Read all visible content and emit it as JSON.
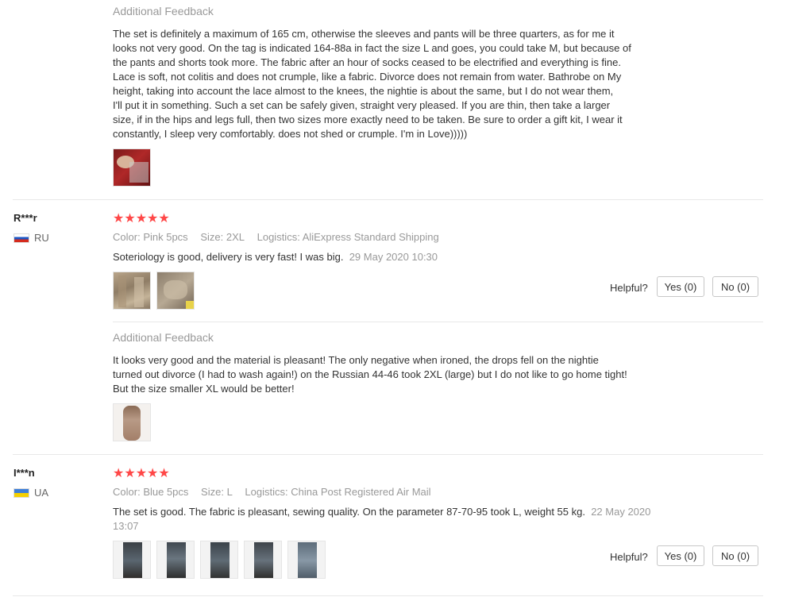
{
  "reviews": [
    {
      "feedback_title": "Additional Feedback",
      "feedback_lines": [
        "The set is definitely a maximum of 165 cm, otherwise the sleeves and pants will be three quarters, as for me it",
        "looks not very good. On the tag is indicated 164-88a in fact the size L and goes, you could take M, but because of",
        "the pants and shorts took more. The fabric after an hour of socks ceased to be electrified and everything is fine.",
        "Lace is soft, not colitis and does not crumple, like a fabric. Divorce does not remain from water. Bathrobe on My",
        "height, taking into account the lace almost to the knees, the nightie is about the same, but I do not wear them,",
        "I'll put it in something. Such a set can be safely given, straight very pleased. If you are thin, then take a larger",
        "size, if in the hips and legs full, then two sizes more exactly need to be taken. Be sure to order a gift kit, I wear it",
        "constantly, I sleep very comfortably. does not shed or crumple. I'm in Love)))))"
      ]
    },
    {
      "user": "R***r",
      "country": "RU",
      "stars": "★★★★★",
      "color_label": "Color:",
      "color_value": "Pink 5pcs",
      "size_label": "Size:",
      "size_value": "2XL",
      "logistics_label": "Logistics:",
      "logistics_value": "AliExpress Standard Shipping",
      "text": "Soteriology is good, delivery is very fast! I was big.",
      "date": "29 May 2020 10:30",
      "helpful_label": "Helpful?",
      "yes_label": "Yes (0)",
      "no_label": "No (0)",
      "feedback_title": "Additional Feedback",
      "feedback_lines": [
        "It looks very good and the material is pleasant! The only negative when ironed, the drops fell on the nightie",
        "turned out divorce (I had to wash again!) on the Russian 44-46 took 2XL (large) but I do not like to go home tight!",
        "But the size smaller XL would be better!"
      ]
    },
    {
      "user": "I***n",
      "country": "UA",
      "stars": "★★★★★",
      "color_label": "Color:",
      "color_value": "Blue 5pcs",
      "size_label": "Size:",
      "size_value": "L",
      "logistics_label": "Logistics:",
      "logistics_value": "China Post Registered Air Mail",
      "text": "The set is good. The fabric is pleasant, sewing quality. On the parameter 87-70-95 took L, weight 55 kg.",
      "date_part1": "22 May 2020",
      "date_part2": "13:07",
      "helpful_label": "Helpful?",
      "yes_label": "Yes (0)",
      "no_label": "No (0)"
    }
  ],
  "colors": {
    "star": "#ff4747",
    "muted": "#999999",
    "divider": "#e8e8e8"
  }
}
